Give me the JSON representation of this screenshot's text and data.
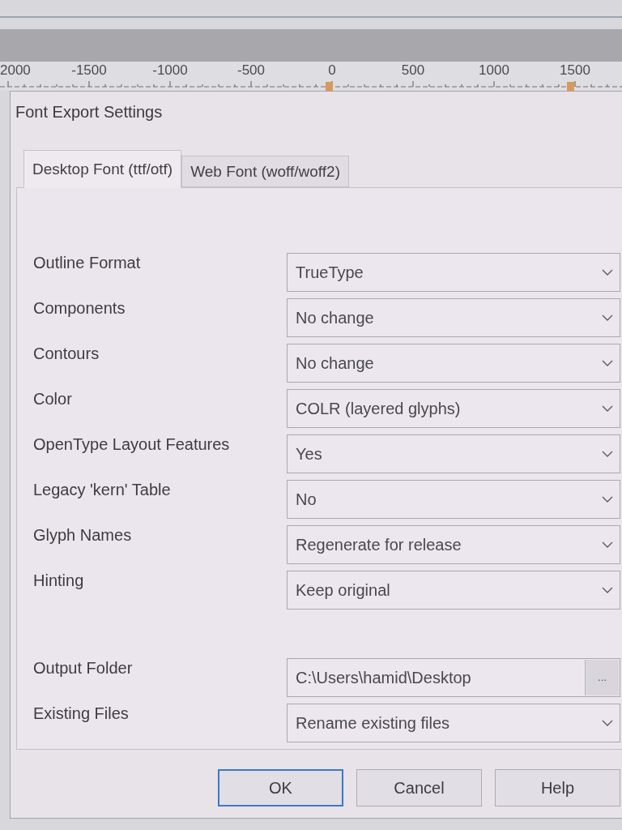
{
  "ruler": {
    "labels": [
      "2000",
      "-1500",
      "-1000",
      "-500",
      "0",
      "500",
      "1000",
      "1500"
    ]
  },
  "dialog": {
    "title": "Font Export Settings",
    "tabs": [
      {
        "label": "Desktop Font (ttf/otf)",
        "selected": true
      },
      {
        "label": "Web Font (woff/woff2)",
        "selected": false
      }
    ],
    "format_settings": [
      {
        "kind": "dropdown",
        "label": "Outline Format",
        "value": "TrueType"
      },
      {
        "kind": "dropdown",
        "label": "Components",
        "value": "No change"
      },
      {
        "kind": "dropdown",
        "label": "Contours",
        "value": "No change"
      },
      {
        "kind": "dropdown",
        "label": "Color",
        "value": "COLR (layered glyphs)"
      },
      {
        "kind": "dropdown",
        "label": "OpenType Layout Features",
        "value": "Yes"
      },
      {
        "kind": "dropdown",
        "label": "Legacy 'kern' Table",
        "value": "No"
      },
      {
        "kind": "dropdown",
        "label": "Glyph Names",
        "value": "Regenerate for release"
      },
      {
        "kind": "dropdown",
        "label": "Hinting",
        "value": "Keep original"
      }
    ],
    "output_settings": [
      {
        "kind": "path",
        "label": "Output Folder",
        "value": "C:\\Users\\hamid\\Desktop",
        "button": "..."
      },
      {
        "kind": "dropdown",
        "label": "Existing Files",
        "value": "Rename existing files"
      }
    ],
    "buttons": [
      {
        "label": "OK",
        "focused": true
      },
      {
        "label": "Cancel",
        "focused": false
      },
      {
        "label": "Help",
        "focused": false
      }
    ]
  }
}
